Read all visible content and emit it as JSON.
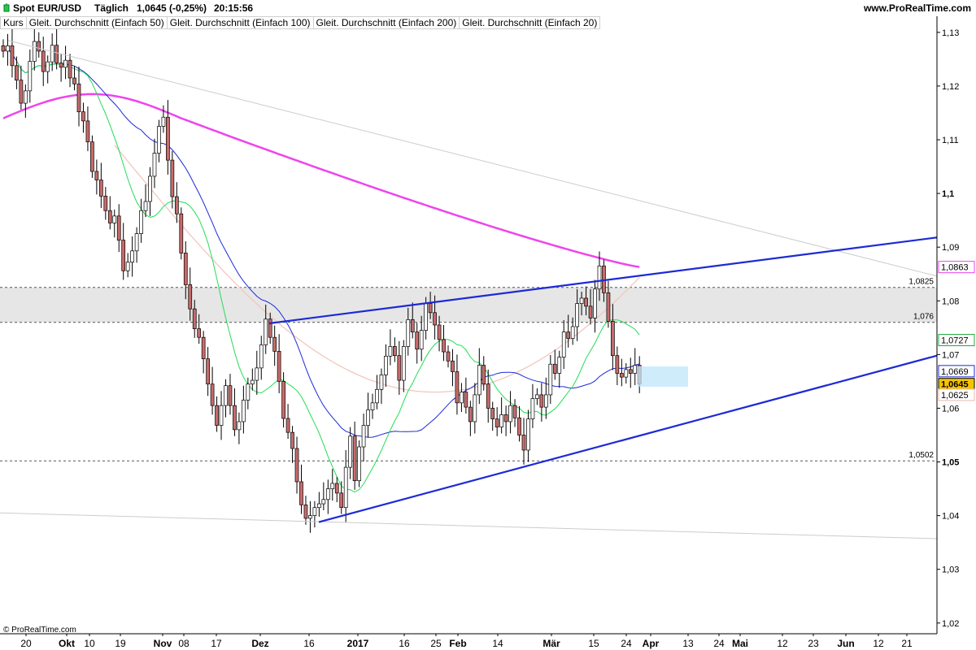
{
  "header": {
    "title": "Spot EUR/USD",
    "timeframe": "Täglich",
    "price": "1,0645 (-0,25%)",
    "time": "20:15:56",
    "brand": "www.ProRealTime.com",
    "copyright": "© ProRealTime.com"
  },
  "legend": [
    {
      "label": "Kurs",
      "color": "#000000"
    },
    {
      "label": "Gleit. Durchschnitt (Einfach 50)",
      "color": "#1c2ad6"
    },
    {
      "label": "Gleit. Durchschnitt (Einfach 100)",
      "color": "#d9c4c4"
    },
    {
      "label": "Gleit. Durchschnitt (Einfach 200)",
      "color": "#ee44ee"
    },
    {
      "label": "Gleit. Durchschnitt (Einfach 20)",
      "color": "#22dd55"
    }
  ],
  "colors": {
    "candle_up": "#ffffff",
    "candle_down": "#c86b6b",
    "ma50": "#1c2ad6",
    "ma100": "#f2c7c0",
    "ma200": "#ee44ee",
    "ma20": "#22dd55",
    "trendline": "#1c2ad6",
    "zone": "#e6e6e6",
    "box": "#bfe6f8"
  },
  "chart_data": {
    "type": "candlestick",
    "ylim": [
      1.018,
      1.133
    ],
    "y_ticks": [
      "1,13",
      "1,12",
      "1,11",
      "1,1",
      "1,09",
      "1,08",
      "1,07",
      "1,06",
      "1,05",
      "1,04",
      "1,03",
      "1,02"
    ],
    "y_tick_values": [
      1.13,
      1.12,
      1.11,
      1.1,
      1.09,
      1.08,
      1.07,
      1.06,
      1.05,
      1.04,
      1.03,
      1.02
    ],
    "x_labels": [
      "20",
      "Okt",
      "10",
      "19",
      "Nov",
      "08",
      "17",
      "Dez",
      "16",
      "2017",
      "16",
      "25",
      "Feb",
      "14",
      "Mär",
      "15",
      "24",
      "Apr",
      "13",
      "24",
      "Mai",
      "12",
      "23",
      "Jun",
      "12",
      "21"
    ],
    "levels": [
      {
        "value": 1.0825,
        "label": "1,0825"
      },
      {
        "value": 1.076,
        "label": "1,076"
      },
      {
        "value": 1.0502,
        "label": "1,0502"
      }
    ],
    "price_tags": [
      {
        "value": 1.0863,
        "label": "1,0863",
        "color": "#ee44ee"
      },
      {
        "value": 1.0727,
        "label": "1,0727",
        "color": "#22aa44"
      },
      {
        "value": 1.0669,
        "label": "1,0669",
        "color": "#1c2ad6"
      },
      {
        "value": 1.0645,
        "label": "1,0645",
        "color": "#000000"
      },
      {
        "value": 1.0625,
        "label": "1,0625",
        "color": "#e8b8b0"
      }
    ],
    "closes": [
      1.1265,
      1.1275,
      1.1238,
      1.1211,
      1.1168,
      1.1191,
      1.1246,
      1.1283,
      1.1265,
      1.1227,
      1.1245,
      1.1276,
      1.1243,
      1.1235,
      1.1248,
      1.1215,
      1.1204,
      1.1152,
      1.1135,
      1.1096,
      1.1041,
      1.1025,
      1.0995,
      1.0968,
      1.0945,
      1.0958,
      1.0913,
      1.0856,
      1.0872,
      1.0893,
      1.0925,
      1.0968,
      1.0985,
      1.1032,
      1.1075,
      1.1125,
      1.1142,
      1.1062,
      1.0994,
      1.0962,
      1.0889,
      1.083,
      1.0785,
      1.0748,
      1.0732,
      1.0692,
      1.0645,
      1.0605,
      1.0568,
      1.0605,
      1.0642,
      1.0605,
      1.056,
      1.0575,
      1.0615,
      1.0645,
      1.0652,
      1.0675,
      1.0718,
      1.0766,
      1.0732,
      1.0706,
      1.065,
      1.0581,
      1.0555,
      1.0525,
      1.0463,
      1.042,
      1.0395,
      1.04,
      1.0415,
      1.0422,
      1.043,
      1.045,
      1.046,
      1.0442,
      1.0415,
      1.049,
      1.0548,
      1.0465,
      1.0528,
      1.0568,
      1.0597,
      1.061,
      1.0635,
      1.0662,
      1.0697,
      1.0715,
      1.0698,
      1.0652,
      1.0715,
      1.0765,
      1.0742,
      1.071,
      1.0745,
      1.0795,
      1.0778,
      1.0755,
      1.0728,
      1.0705,
      1.0688,
      1.0668,
      1.061,
      1.063,
      1.0602,
      1.0575,
      1.0625,
      1.068,
      1.0645,
      1.06,
      1.058,
      1.0565,
      1.0588,
      1.0575,
      1.0605,
      1.0582,
      1.055,
      1.0522,
      1.058,
      1.0618,
      1.0625,
      1.0602,
      1.0625,
      1.0682,
      1.0665,
      1.0695,
      1.0742,
      1.073,
      1.0752,
      1.0795,
      1.0805,
      1.079,
      1.0768,
      1.0822,
      1.0865,
      1.0815,
      1.0762,
      1.0698,
      1.0665,
      1.0658,
      1.0672,
      1.0665,
      1.068,
      1.0645
    ]
  }
}
